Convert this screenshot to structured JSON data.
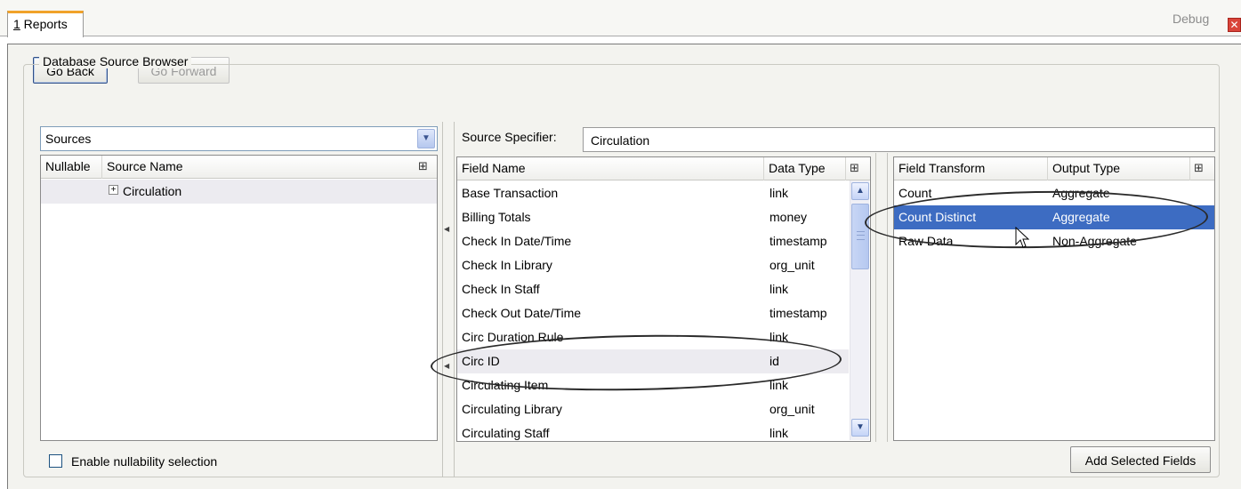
{
  "tab": {
    "prefix": "1",
    "label": " Reports"
  },
  "toolbar": {
    "go_back": "Go Back",
    "go_forward": "Go Forward",
    "debug": "Debug"
  },
  "browser": {
    "legend": "Database Source Browser",
    "sources_combo": "Sources",
    "source_columns": [
      "Nullable",
      "Source Name"
    ],
    "source_tree": [
      {
        "expander": "+",
        "label": "Circulation"
      }
    ],
    "nullability_label": "Enable nullability selection"
  },
  "specifier": {
    "label": "Source Specifier:",
    "value": "Circulation"
  },
  "fields": {
    "columns": [
      "Field Name",
      "Data Type"
    ],
    "rows": [
      {
        "name": "Base Transaction",
        "type": "link"
      },
      {
        "name": "Billing Totals",
        "type": "money"
      },
      {
        "name": "Check In Date/Time",
        "type": "timestamp"
      },
      {
        "name": "Check In Library",
        "type": "org_unit"
      },
      {
        "name": "Check In Staff",
        "type": "link"
      },
      {
        "name": "Check Out Date/Time",
        "type": "timestamp"
      },
      {
        "name": "Circ Duration Rule",
        "type": "link"
      },
      {
        "name": "Circ ID",
        "type": "id"
      },
      {
        "name": "Circulating Item",
        "type": "link"
      },
      {
        "name": "Circulating Library",
        "type": "org_unit"
      },
      {
        "name": "Circulating Staff",
        "type": "link"
      }
    ]
  },
  "transforms": {
    "columns": [
      "Field Transform",
      "Output Type"
    ],
    "rows": [
      {
        "name": "Count",
        "type": "Aggregate"
      },
      {
        "name": "Count Distinct",
        "type": "Aggregate"
      },
      {
        "name": "Raw Data",
        "type": "Non-Aggregate"
      }
    ],
    "add_button": "Add Selected Fields"
  },
  "colors": {
    "selection": "#3d6cc2",
    "tab_accent": "#f0a22a",
    "close": "#d9443a"
  }
}
